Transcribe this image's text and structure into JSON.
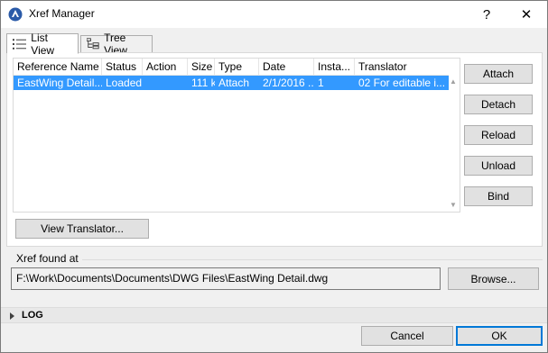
{
  "window": {
    "title": "Xref Manager",
    "help_label": "?",
    "close_label": "✕",
    "icon": "xref-app-icon"
  },
  "tabs": [
    {
      "label": "List View",
      "icon": "list-view-icon",
      "active": true
    },
    {
      "label": "Tree View",
      "icon": "tree-view-icon",
      "active": false
    }
  ],
  "table": {
    "columns": [
      "Reference Name",
      "Status",
      "Action",
      "Size",
      "Type",
      "Date",
      "Insta...",
      "Translator"
    ],
    "sorted_column": "Reference Name",
    "rows": [
      {
        "selected": true,
        "cells": [
          "EastWing Detail....",
          "Loaded",
          "",
          "111 k",
          "Attach",
          "2/1/2016 ...",
          "1",
          "02 For editable i..."
        ]
      }
    ]
  },
  "side_buttons": [
    "Attach",
    "Detach",
    "Reload",
    "Unload",
    "Bind"
  ],
  "view_translator_label": "View Translator...",
  "xref_found": {
    "label": "Xref found at",
    "path": "F:\\Work\\Documents\\Documents\\DWG Files\\EastWing Detail.dwg",
    "browse_label": "Browse..."
  },
  "log_label": "LOG",
  "footer": {
    "cancel_label": "Cancel",
    "ok_label": "OK"
  },
  "colors": {
    "selection": "#3399ff",
    "ok_border": "#0078d7"
  }
}
